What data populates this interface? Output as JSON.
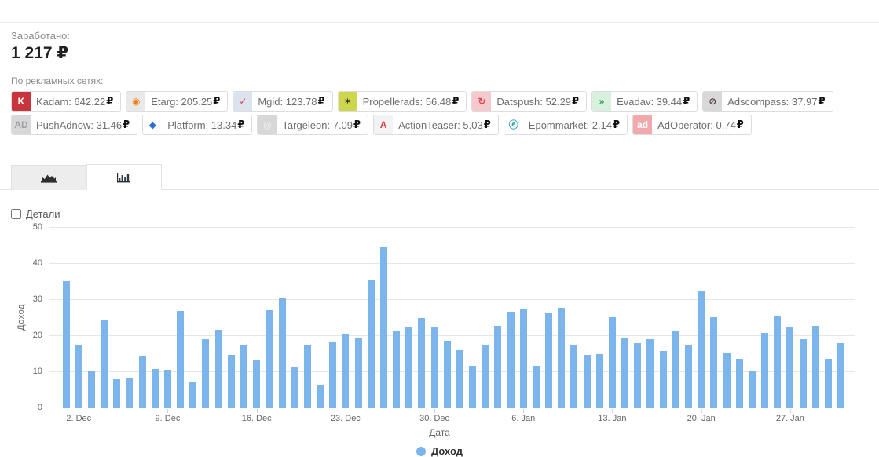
{
  "header": {
    "earned_label": "Заработано:",
    "earned_value": "1 217",
    "currency": "₽",
    "networks_label": "По рекламных сетях:"
  },
  "networks": [
    {
      "name": "Kadam",
      "value": "642.22",
      "icon": {
        "glyph": "K",
        "bg": "#c9353d",
        "fg": "#ffffff"
      }
    },
    {
      "name": "Etarg",
      "value": "205.25",
      "icon": {
        "glyph": "◉",
        "bg": "#e9e9e9",
        "fg": "#f07f1a"
      }
    },
    {
      "name": "Mgid",
      "value": "123.78",
      "icon": {
        "glyph": "✓",
        "bg": "#dde3ee",
        "fg": "#d04a43"
      }
    },
    {
      "name": "Propellerads",
      "value": "56.48",
      "icon": {
        "glyph": "✶",
        "bg": "#cdd64d",
        "fg": "#33331c"
      }
    },
    {
      "name": "Datspush",
      "value": "52.29",
      "icon": {
        "glyph": "↻",
        "bg": "#f6c9cd",
        "fg": "#e04550"
      }
    },
    {
      "name": "Evadav",
      "value": "39.44",
      "icon": {
        "glyph": "»",
        "bg": "#d9f0df",
        "fg": "#2f9e5f"
      }
    },
    {
      "name": "Adscompass",
      "value": "37.97",
      "icon": {
        "glyph": "⊘",
        "bg": "#d8d8d8",
        "fg": "#4a3f44"
      }
    },
    {
      "name": "PushAdnow",
      "value": "31.46",
      "icon": {
        "glyph": "AD",
        "bg": "#d8d8d8",
        "fg": "#9aa0a6"
      }
    },
    {
      "name": "Platform",
      "value": "13.34",
      "icon": {
        "glyph": "◆",
        "bg": "#ffffff",
        "fg": "#2b6fd4"
      }
    },
    {
      "name": "Targeleon",
      "value": "7.09",
      "icon": {
        "glyph": "◎",
        "bg": "#d8d8d8",
        "fg": "#f2f2f2"
      }
    },
    {
      "name": "ActionTeaser",
      "value": "5.03",
      "icon": {
        "glyph": "A",
        "bg": "#f2f3f7",
        "fg": "#e03c31"
      }
    },
    {
      "name": "Epommarket",
      "value": "2.14",
      "icon": {
        "glyph": "ⓔ",
        "bg": "#ffffff",
        "fg": "#2aa7b4"
      }
    },
    {
      "name": "AdOperator",
      "value": "0.74",
      "icon": {
        "glyph": "ad",
        "bg": "#f0a9ad",
        "fg": "#ffffff"
      }
    }
  ],
  "tabs": [
    {
      "icon": "area-chart-icon",
      "active": false
    },
    {
      "icon": "bar-chart-icon",
      "active": true
    }
  ],
  "details_label": "Детали",
  "chart_data": {
    "type": "bar",
    "title": "",
    "xlabel": "Дата",
    "ylabel": "Доход",
    "ylim": [
      0,
      50
    ],
    "yticks": [
      0,
      10,
      20,
      30,
      40,
      50
    ],
    "grid": true,
    "bar_color": "#7cb5ec",
    "legend": {
      "label": "Доход",
      "color": "#7cb5ec",
      "position": "bottom-center"
    },
    "categories": [
      "1. Dec",
      "2. Dec",
      "3. Dec",
      "4. Dec",
      "5. Dec",
      "6. Dec",
      "7. Dec",
      "8. Dec",
      "9. Dec",
      "10. Dec",
      "11. Dec",
      "12. Dec",
      "13. Dec",
      "14. Dec",
      "15. Dec",
      "16. Dec",
      "17. Dec",
      "18. Dec",
      "19. Dec",
      "20. Dec",
      "21. Dec",
      "22. Dec",
      "23. Dec",
      "24. Dec",
      "25. Dec",
      "26. Dec",
      "27. Dec",
      "28. Dec",
      "29. Dec",
      "30. Dec",
      "31. Dec",
      "1. Jan",
      "2. Jan",
      "3. Jan",
      "4. Jan",
      "5. Jan",
      "6. Jan",
      "7. Jan",
      "8. Jan",
      "9. Jan",
      "10. Jan",
      "11. Jan",
      "12. Jan",
      "13. Jan",
      "14. Jan",
      "15. Jan",
      "16. Jan",
      "17. Jan",
      "18. Jan",
      "19. Jan",
      "20. Jan",
      "21. Jan",
      "22. Jan",
      "23. Jan",
      "24. Jan",
      "25. Jan",
      "26. Jan",
      "27. Jan",
      "28. Jan",
      "29. Jan",
      "30. Jan",
      "31. Jan"
    ],
    "values": [
      35.2,
      17.3,
      10.4,
      24.6,
      8.0,
      8.3,
      14.4,
      10.9,
      10.6,
      26.9,
      7.5,
      19.1,
      21.8,
      14.7,
      17.6,
      13.2,
      27.2,
      30.7,
      11.4,
      17.4,
      6.6,
      18.3,
      20.6,
      19.3,
      35.6,
      44.5,
      21.2,
      22.3,
      25.1,
      22.3,
      18.8,
      16.1,
      11.8,
      17.5,
      22.8,
      26.8,
      27.6,
      11.8,
      26.3,
      27.9,
      17.4,
      14.7,
      15.1,
      25.2,
      19.3,
      18.1,
      19.1,
      15.8,
      21.4,
      17.5,
      32.3,
      25.2,
      15.2,
      13.7,
      10.5,
      20.8,
      25.4,
      22.3,
      19.2,
      22.8,
      13.6,
      18.1
    ],
    "x_tick_labels": [
      {
        "index": 1,
        "label": "2. Dec"
      },
      {
        "index": 8,
        "label": "9. Dec"
      },
      {
        "index": 15,
        "label": "16. Dec"
      },
      {
        "index": 22,
        "label": "23. Dec"
      },
      {
        "index": 29,
        "label": "30. Dec"
      },
      {
        "index": 36,
        "label": "6. Jan"
      },
      {
        "index": 43,
        "label": "13. Jan"
      },
      {
        "index": 50,
        "label": "20. Jan"
      },
      {
        "index": 57,
        "label": "27. Jan"
      }
    ]
  }
}
